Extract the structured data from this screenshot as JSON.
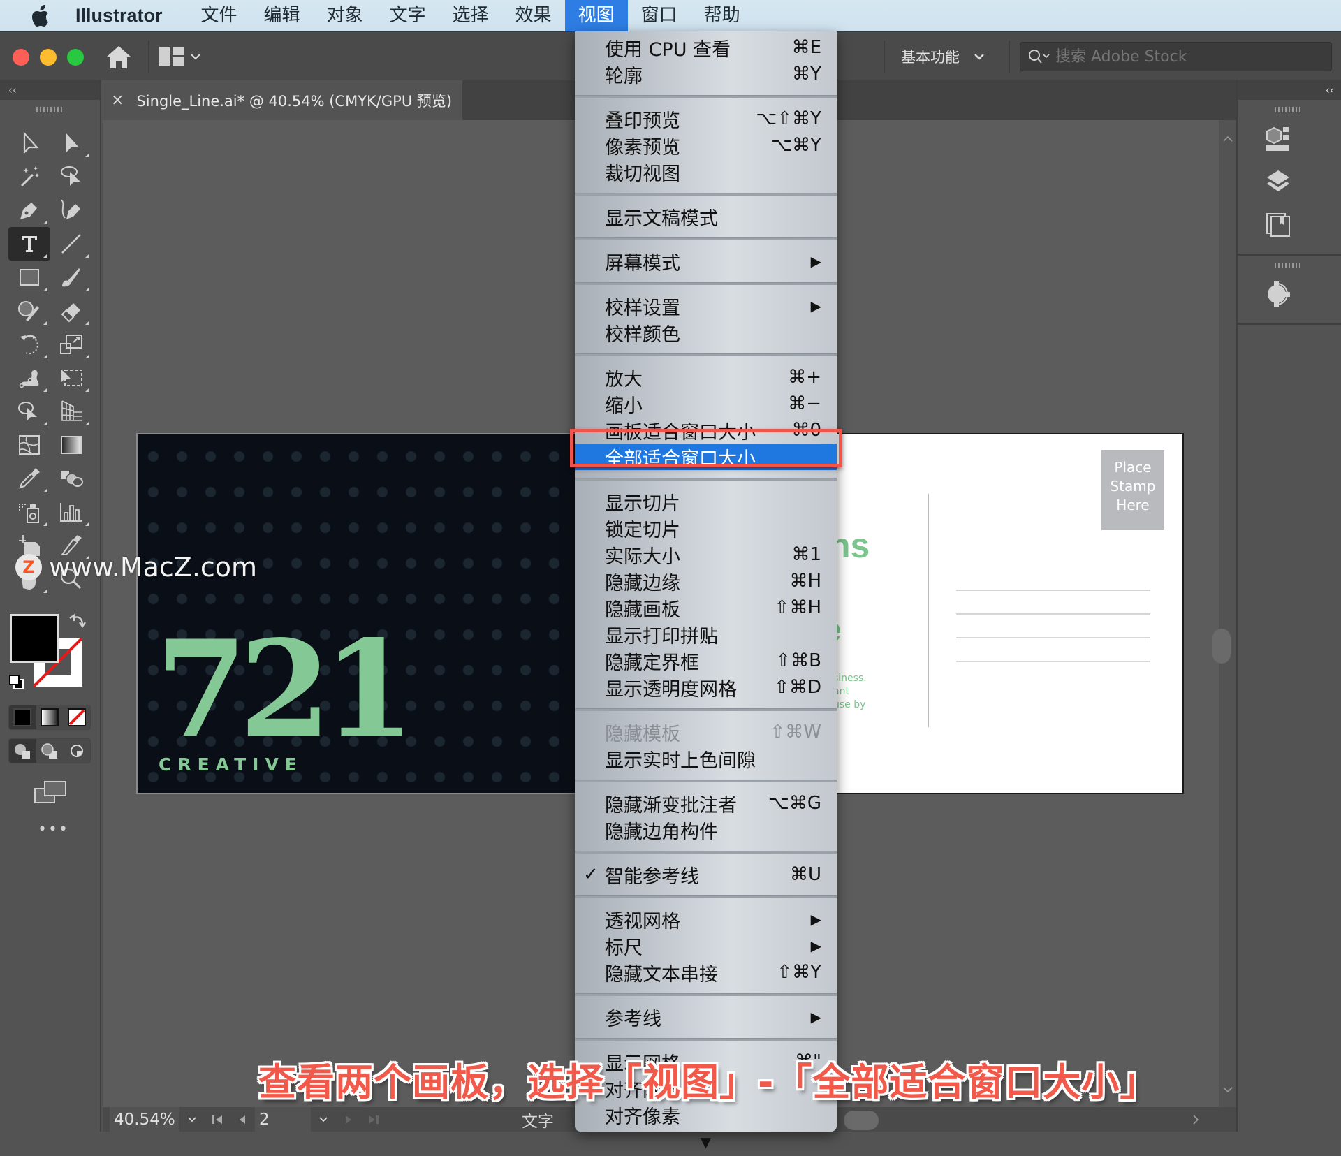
{
  "menubar": {
    "app_name": "Illustrator",
    "items": [
      "文件",
      "编辑",
      "对象",
      "文字",
      "选择",
      "效果",
      "视图",
      "窗口",
      "帮助"
    ],
    "active_item": "视图"
  },
  "controlbar": {
    "workspace_label": "基本功能",
    "stock_search_placeholder": "搜索 Adobe Stock"
  },
  "document_tab": {
    "title": "Single_Line.ai* @ 40.54% (CMYK/GPU 预览)",
    "close_glyph": "×"
  },
  "toolbar": {
    "collapse_glyph": "‹‹",
    "tools": [
      {
        "name": "selection-tool"
      },
      {
        "name": "direct-selection-tool"
      },
      {
        "name": "magic-wand-tool"
      },
      {
        "name": "lasso-tool"
      },
      {
        "name": "pen-tool"
      },
      {
        "name": "curvature-tool"
      },
      {
        "name": "type-tool",
        "selected": true
      },
      {
        "name": "line-segment-tool"
      },
      {
        "name": "rectangle-tool"
      },
      {
        "name": "paintbrush-tool"
      },
      {
        "name": "shaper-tool"
      },
      {
        "name": "eraser-tool"
      },
      {
        "name": "rotate-tool"
      },
      {
        "name": "scale-tool"
      },
      {
        "name": "puppet-warp-tool"
      },
      {
        "name": "free-transform-tool"
      },
      {
        "name": "shape-builder-tool"
      },
      {
        "name": "perspective-grid-tool"
      },
      {
        "name": "mesh-tool"
      },
      {
        "name": "gradient-tool"
      },
      {
        "name": "eyedropper-tool"
      },
      {
        "name": "blend-tool"
      },
      {
        "name": "symbol-sprayer-tool"
      },
      {
        "name": "column-graph-tool"
      },
      {
        "name": "artboard-tool"
      },
      {
        "name": "slice-tool"
      },
      {
        "name": "hand-tool"
      },
      {
        "name": "zoom-tool"
      }
    ],
    "fill_color": "#000000",
    "stroke": "none",
    "more_glyph": "•••"
  },
  "view_menu": {
    "sections": [
      [
        {
          "label": "使用 CPU 查看",
          "shortcut": "⌘E"
        },
        {
          "label": "轮廓",
          "shortcut": "⌘Y"
        }
      ],
      [
        {
          "label": "叠印预览",
          "shortcut": "⌥⇧⌘Y"
        },
        {
          "label": "像素预览",
          "shortcut": "⌥⌘Y"
        },
        {
          "label": "裁切视图",
          "shortcut": ""
        }
      ],
      [
        {
          "label": "显示文稿模式",
          "shortcut": ""
        }
      ],
      [
        {
          "label": "屏幕模式",
          "submenu": true
        }
      ],
      [
        {
          "label": "校样设置",
          "submenu": true
        },
        {
          "label": "校样颜色",
          "shortcut": ""
        }
      ],
      [
        {
          "label": "放大",
          "shortcut": "⌘+"
        },
        {
          "label": "缩小",
          "shortcut": "⌘−"
        },
        {
          "label": "画板适合窗口大小",
          "shortcut": "⌘0"
        },
        {
          "label": "全部适合窗口大小",
          "shortcut": "",
          "highlighted": true
        }
      ],
      [
        {
          "label": "显示切片",
          "shortcut": ""
        },
        {
          "label": "锁定切片",
          "shortcut": ""
        },
        {
          "label": "实际大小",
          "shortcut": "⌘1"
        },
        {
          "label": "隐藏边缘",
          "shortcut": "⌘H"
        },
        {
          "label": "隐藏画板",
          "shortcut": "⇧⌘H"
        },
        {
          "label": "显示打印拼贴",
          "shortcut": ""
        },
        {
          "label": "隐藏定界框",
          "shortcut": "⇧⌘B"
        },
        {
          "label": "显示透明度网格",
          "shortcut": "⇧⌘D"
        }
      ],
      [
        {
          "label": "隐藏模板",
          "shortcut": "⇧⌘W",
          "disabled": true
        },
        {
          "label": "显示实时上色间隙",
          "shortcut": ""
        }
      ],
      [
        {
          "label": "隐藏渐变批注者",
          "shortcut": "⌥⌘G"
        },
        {
          "label": "隐藏边角构件",
          "shortcut": ""
        }
      ],
      [
        {
          "label": "智能参考线",
          "shortcut": "⌘U",
          "checked": true
        }
      ],
      [
        {
          "label": "透视网格",
          "submenu": true
        },
        {
          "label": "标尺",
          "submenu": true
        },
        {
          "label": "隐藏文本串接",
          "shortcut": "⇧⌘Y"
        }
      ],
      [
        {
          "label": "参考线",
          "submenu": true
        }
      ],
      [
        {
          "label": "显示网格",
          "shortcut": "⌘\""
        },
        {
          "label": "对齐网格",
          "shortcut": ""
        },
        {
          "label": "对齐像素",
          "shortcut": ""
        }
      ]
    ],
    "check_glyph": "✓",
    "submenu_glyph": "▶",
    "scroll_down_glyph": "▼"
  },
  "artboards": {
    "left": {
      "logo_number": "721",
      "logo_subtitle": "CREATIVE",
      "bg_color": "#0a0f17",
      "accent_color": "#84c995"
    },
    "right": {
      "partial_heading": "ns",
      "partial_letter": "e",
      "partial_body": [
        "siness.",
        "ant",
        "use by"
      ],
      "stamp_text": [
        "Place",
        "Stamp",
        "Here"
      ],
      "address_lines": 4
    }
  },
  "right_panel": {
    "collapse_glyph": "‹‹",
    "icons": [
      "libraries-icon",
      "layers-icon",
      "artboards-icon",
      "properties-icon"
    ]
  },
  "statusbar": {
    "zoom_value": "40.54%",
    "artboard_number": "2",
    "status_text": "文字"
  },
  "overlay": {
    "watermark": "www.MacZ.com",
    "watermark_badge": "Z",
    "caption": "查看两个画板，选择「视图」-「全部适合窗口大小」",
    "highlight_color": "#f0544a"
  }
}
